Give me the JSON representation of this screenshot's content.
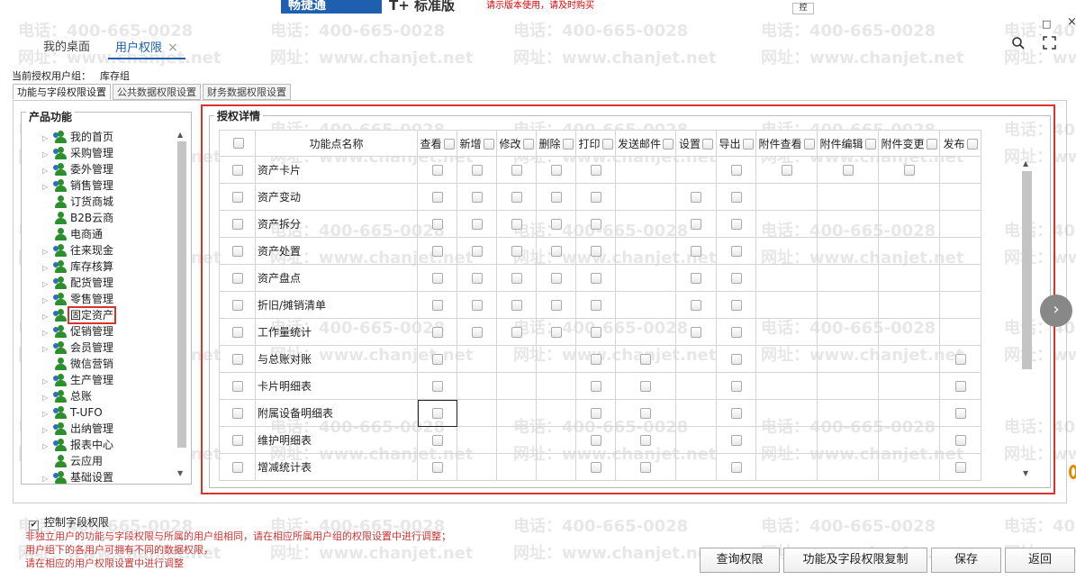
{
  "topbar": {
    "brand": "畅捷通",
    "edition": "T+ 标准版",
    "note": "请示版本使用，请及时购买",
    "ctrl": "控"
  },
  "window": {
    "minimize": "□",
    "close": "×"
  },
  "tabs": [
    {
      "label": "我的桌面"
    },
    {
      "label": "用户权限",
      "close": "×"
    }
  ],
  "current_group": {
    "label": "当前授权用户组：",
    "value": "库存组"
  },
  "subtabs": [
    "功能与字段权限设置",
    "公共数据权限设置",
    "财务数据权限设置"
  ],
  "tree": {
    "title": "产品功能",
    "items": [
      {
        "label": "我的首页",
        "arrow": "▷"
      },
      {
        "label": "采购管理",
        "arrow": "▷"
      },
      {
        "label": "委外管理",
        "arrow": "▷"
      },
      {
        "label": "销售管理",
        "arrow": "▷"
      },
      {
        "label": "订货商城",
        "arrow": ""
      },
      {
        "label": "B2B云商",
        "arrow": ""
      },
      {
        "label": "电商通",
        "arrow": ""
      },
      {
        "label": "往来现金",
        "arrow": "▷"
      },
      {
        "label": "库存核算",
        "arrow": "▷"
      },
      {
        "label": "配货管理",
        "arrow": "▷"
      },
      {
        "label": "零售管理",
        "arrow": "▷"
      },
      {
        "label": "固定资产",
        "arrow": "▷",
        "selected": true
      },
      {
        "label": "促销管理",
        "arrow": "▷"
      },
      {
        "label": "会员管理",
        "arrow": "▷"
      },
      {
        "label": "微信营销",
        "arrow": ""
      },
      {
        "label": "生产管理",
        "arrow": "▷"
      },
      {
        "label": "总账",
        "arrow": "▷"
      },
      {
        "label": "T-UFO",
        "arrow": "▷"
      },
      {
        "label": "出纳管理",
        "arrow": "▷"
      },
      {
        "label": "报表中心",
        "arrow": "▷"
      },
      {
        "label": "云应用",
        "arrow": ""
      },
      {
        "label": "基础设置",
        "arrow": "▷"
      }
    ]
  },
  "detail": {
    "title": "授权详情",
    "columns": [
      {
        "key": "name",
        "label": "功能点名称"
      },
      {
        "key": "view",
        "label": "查看"
      },
      {
        "key": "add",
        "label": "新增"
      },
      {
        "key": "edit",
        "label": "修改"
      },
      {
        "key": "del",
        "label": "删除"
      },
      {
        "key": "print",
        "label": "打印"
      },
      {
        "key": "mail",
        "label": "发送邮件"
      },
      {
        "key": "setup",
        "label": "设置"
      },
      {
        "key": "export",
        "label": "导出"
      },
      {
        "key": "attview",
        "label": "附件查看"
      },
      {
        "key": "attedit",
        "label": "附件编辑"
      },
      {
        "key": "attchg",
        "label": "附件变更"
      },
      {
        "key": "publish",
        "label": "发布"
      }
    ],
    "rows": [
      {
        "name": "资产卡片",
        "cells": {
          "view": true,
          "add": true,
          "edit": true,
          "del": true,
          "print": true,
          "export": true,
          "attview": true,
          "attedit": true,
          "attchg": true
        }
      },
      {
        "name": "资产变动",
        "cells": {
          "view": true,
          "add": true,
          "edit": true,
          "del": true,
          "print": true,
          "setup": true,
          "export": true
        }
      },
      {
        "name": "资产拆分",
        "cells": {
          "view": true,
          "add": true,
          "edit": true,
          "del": true,
          "print": true,
          "setup": true,
          "export": true
        }
      },
      {
        "name": "资产处置",
        "cells": {
          "view": true,
          "add": true,
          "edit": true,
          "del": true,
          "print": true,
          "setup": true,
          "export": true
        }
      },
      {
        "name": "资产盘点",
        "cells": {
          "view": true,
          "add": true,
          "edit": true,
          "del": true,
          "print": true,
          "setup": true,
          "export": true
        }
      },
      {
        "name": "折旧/摊销清单",
        "cells": {
          "view": true,
          "add": true,
          "edit": true,
          "del": true,
          "print": true,
          "setup": true,
          "export": true
        }
      },
      {
        "name": "工作量统计",
        "cells": {
          "view": true,
          "add": true,
          "edit": true,
          "del": true,
          "print": true,
          "setup": true,
          "export": true
        }
      },
      {
        "name": "与总账对账",
        "cells": {
          "view": true,
          "print": true,
          "mail": true,
          "export": true,
          "publish": true
        }
      },
      {
        "name": "卡片明细表",
        "cells": {
          "view": true,
          "print": true,
          "mail": true,
          "export": true,
          "publish": true
        }
      },
      {
        "name": "附属设备明细表",
        "cells": {
          "view": true,
          "print": true,
          "mail": true,
          "export": true,
          "publish": true
        },
        "focus": "view"
      },
      {
        "name": "维护明细表",
        "cells": {
          "view": true,
          "print": true,
          "mail": true,
          "export": true,
          "publish": true
        }
      },
      {
        "name": "增减统计表",
        "cells": {
          "view": true,
          "print": true,
          "mail": true,
          "export": true,
          "publish": true
        }
      }
    ]
  },
  "bottom": {
    "control_field": "控制字段权限",
    "control_checked": "✔",
    "notes": [
      "非独立用户的功能与字段权限与所属的用户组相同，请在相应所属用户组的权限设置中进行调整；",
      "用户组下的各用户可拥有不同的数据权限，",
      "请在相应的用户权限设置中进行调整"
    ],
    "buttons": {
      "query": "查询权限",
      "copy": "功能及字段权限复制",
      "save": "保存",
      "back": "返回"
    }
  },
  "watermark": {
    "phone": "电话：400-665-0028",
    "site": "网址：www.chanjet.net"
  },
  "icons": {
    "search": "search-icon",
    "fullscreen": "fullscreen-icon",
    "next": "chevron-right-icon"
  },
  "colors": {
    "accent": "#1d5fb0",
    "highlight": "#d9342b",
    "note": "#cc3333"
  }
}
